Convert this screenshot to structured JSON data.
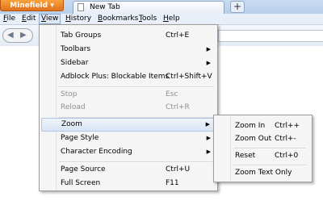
{
  "app_button": "Minefield",
  "tab": {
    "title": "New Tab"
  },
  "new_tab_button": "+",
  "menubar": [
    "File",
    "Edit",
    "View",
    "History",
    "Bookmarks",
    "Tools",
    "Help"
  ],
  "view_menu": [
    {
      "label": "Tab Groups",
      "shortcut": "Ctrl+E"
    },
    {
      "label": "Toolbars",
      "shortcut": ""
    },
    {
      "label": "Sidebar",
      "shortcut": ""
    },
    {
      "label": "Adblock Plus: Blockable Items",
      "shortcut": "Ctrl+Shift+V"
    },
    {
      "label": "Stop",
      "shortcut": "Esc"
    },
    {
      "label": "Reload",
      "shortcut": "Ctrl+R"
    },
    {
      "label": "Zoom",
      "shortcut": ""
    },
    {
      "label": "Page Style",
      "shortcut": ""
    },
    {
      "label": "Character Encoding",
      "shortcut": ""
    },
    {
      "label": "Page Source",
      "shortcut": "Ctrl+U"
    },
    {
      "label": "Full Screen",
      "shortcut": "F11"
    }
  ],
  "zoom_menu": [
    {
      "label": "Zoom In",
      "shortcut": "Ctrl++"
    },
    {
      "label": "Zoom Out",
      "shortcut": "Ctrl+-"
    },
    {
      "label": "Reset",
      "shortcut": "Ctrl+0"
    },
    {
      "label": "Zoom Text Only",
      "shortcut": ""
    }
  ]
}
